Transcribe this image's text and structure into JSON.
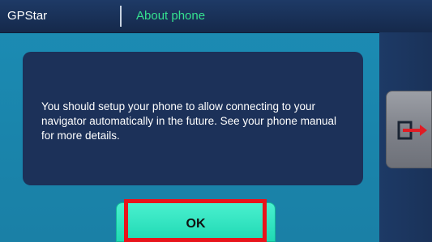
{
  "titlebar": {
    "app_title": "GPStar",
    "page_title": "About phone"
  },
  "message": {
    "text": "You should setup your phone to allow connecting to your navigator automatically in the future. See your phone manual for more details."
  },
  "buttons": {
    "ok_label": "OK",
    "exit_icon": "exit-icon"
  },
  "colors": {
    "background": "#1b86ad",
    "titlebar": "#1e3a66",
    "page_title": "#35e08f",
    "message_box": "#1c3159",
    "ok_button": "#2ee3bf",
    "highlight": "#e8141b",
    "exit_arrow": "#e01c24"
  }
}
